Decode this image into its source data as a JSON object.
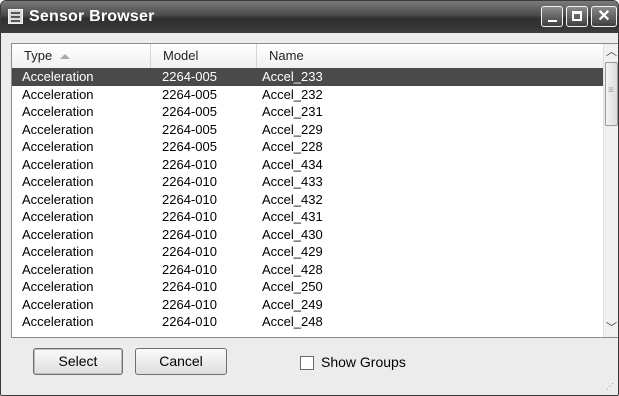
{
  "window": {
    "title": "Sensor Browser"
  },
  "columns": [
    "Type",
    "Model",
    "Name"
  ],
  "sort_column": "Type",
  "rows": [
    {
      "type": "Acceleration",
      "model": "2264-005",
      "name": "Accel_233",
      "selected": true
    },
    {
      "type": "Acceleration",
      "model": "2264-005",
      "name": "Accel_232"
    },
    {
      "type": "Acceleration",
      "model": "2264-005",
      "name": "Accel_231"
    },
    {
      "type": "Acceleration",
      "model": "2264-005",
      "name": "Accel_229"
    },
    {
      "type": "Acceleration",
      "model": "2264-005",
      "name": "Accel_228"
    },
    {
      "type": "Acceleration",
      "model": "2264-010",
      "name": "Accel_434"
    },
    {
      "type": "Acceleration",
      "model": "2264-010",
      "name": "Accel_433"
    },
    {
      "type": "Acceleration",
      "model": "2264-010",
      "name": "Accel_432"
    },
    {
      "type": "Acceleration",
      "model": "2264-010",
      "name": "Accel_431"
    },
    {
      "type": "Acceleration",
      "model": "2264-010",
      "name": "Accel_430"
    },
    {
      "type": "Acceleration",
      "model": "2264-010",
      "name": "Accel_429"
    },
    {
      "type": "Acceleration",
      "model": "2264-010",
      "name": "Accel_428"
    },
    {
      "type": "Acceleration",
      "model": "2264-010",
      "name": "Accel_250"
    },
    {
      "type": "Acceleration",
      "model": "2264-010",
      "name": "Accel_249"
    },
    {
      "type": "Acceleration",
      "model": "2264-010",
      "name": "Accel_248"
    }
  ],
  "buttons": {
    "select": "Select",
    "cancel": "Cancel"
  },
  "show_groups": {
    "label": "Show Groups",
    "checked": false
  },
  "icons": {
    "app": "list-window-icon",
    "minimize": "minimize-icon",
    "maximize": "maximize-icon",
    "close": "close-icon",
    "sort": "sort-ascending-icon",
    "scroll_up": "chevron-up-icon",
    "scroll_down": "chevron-down-icon"
  }
}
